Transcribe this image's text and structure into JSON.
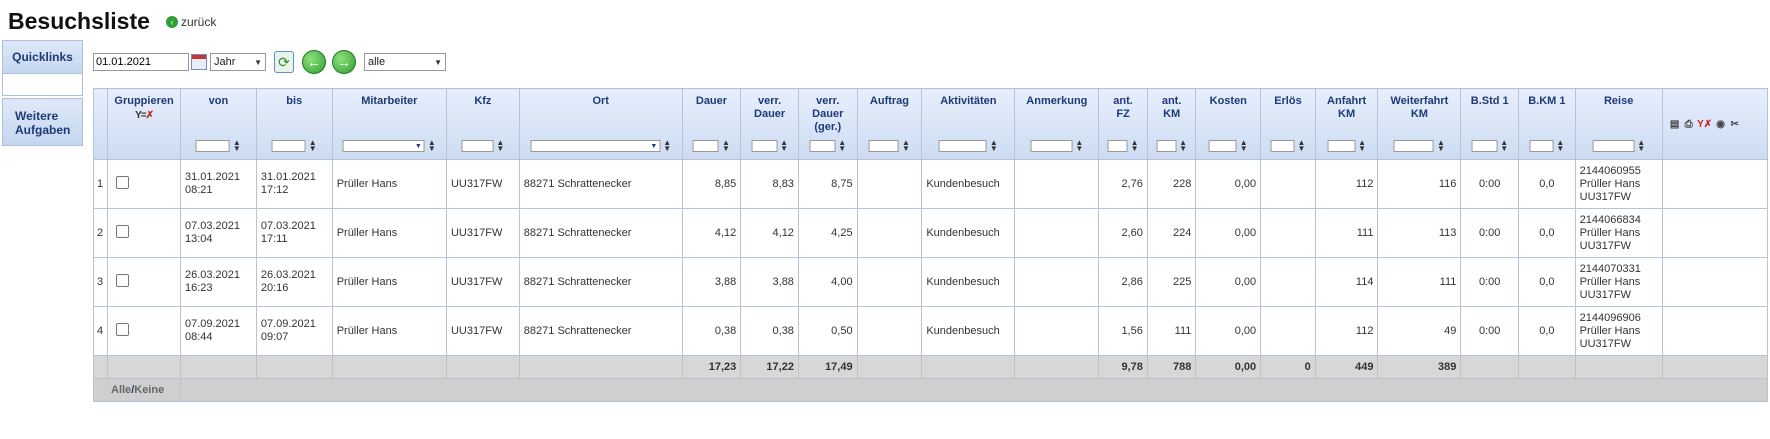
{
  "page": {
    "title": "Besuchsliste",
    "back_label": "zurück"
  },
  "sidebar": {
    "quicklinks": "Quicklinks",
    "tasks": "Weitere Aufgaben"
  },
  "filter": {
    "date": "01.01.2021",
    "period": "Jahr",
    "scope": "alle"
  },
  "table": {
    "headers": {
      "gruppieren": "Gruppieren",
      "von": "von",
      "bis": "bis",
      "mitarbeiter": "Mitarbeiter",
      "kfz": "Kfz",
      "ort": "Ort",
      "dauer": "Dauer",
      "verr_dauer": "verr. Dauer",
      "verr_dauer_ger": "verr. Dauer (ger.)",
      "auftrag": "Auftrag",
      "aktivitaeten": "Aktivitäten",
      "anmerkung": "Anmerkung",
      "ant_fz": "ant. FZ",
      "ant_km": "ant. KM",
      "kosten": "Kosten",
      "erloes": "Erlös",
      "anfahrt_km": "Anfahrt KM",
      "weiterfahrt_km": "Weiterfahrt KM",
      "bstd1": "B.Std 1",
      "bkm1": "B.KM 1",
      "reise": "Reise"
    },
    "rows": [
      {
        "idx": "1",
        "von": "31.01.2021 08:21",
        "bis": "31.01.2021 17:12",
        "mitarbeiter": "Prüller Hans",
        "kfz": "UU317FW",
        "ort": "88271 Schrattenecker",
        "dauer": "8,85",
        "verr_dauer": "8,83",
        "verr_dauer_ger": "8,75",
        "auftrag": "",
        "aktivitaeten": "Kundenbesuch",
        "anmerkung": "",
        "ant_fz": "2,76",
        "ant_km": "228",
        "kosten": "0,00",
        "erloes": "",
        "anfahrt_km": "112",
        "weiterfahrt_km": "116",
        "bstd1": "0:00",
        "bkm1": "0,0",
        "reise_id": "2144060955",
        "reise_name": "Prüller Hans",
        "reise_kfz": "UU317FW"
      },
      {
        "idx": "2",
        "von": "07.03.2021 13:04",
        "bis": "07.03.2021 17:11",
        "mitarbeiter": "Prüller Hans",
        "kfz": "UU317FW",
        "ort": "88271 Schrattenecker",
        "dauer": "4,12",
        "verr_dauer": "4,12",
        "verr_dauer_ger": "4,25",
        "auftrag": "",
        "aktivitaeten": "Kundenbesuch",
        "anmerkung": "",
        "ant_fz": "2,60",
        "ant_km": "224",
        "kosten": "0,00",
        "erloes": "",
        "anfahrt_km": "111",
        "weiterfahrt_km": "113",
        "bstd1": "0:00",
        "bkm1": "0,0",
        "reise_id": "2144066834",
        "reise_name": "Prüller Hans",
        "reise_kfz": "UU317FW"
      },
      {
        "idx": "3",
        "von": "26.03.2021 16:23",
        "bis": "26.03.2021 20:16",
        "mitarbeiter": "Prüller Hans",
        "kfz": "UU317FW",
        "ort": "88271 Schrattenecker",
        "dauer": "3,88",
        "verr_dauer": "3,88",
        "verr_dauer_ger": "4,00",
        "auftrag": "",
        "aktivitaeten": "Kundenbesuch",
        "anmerkung": "",
        "ant_fz": "2,86",
        "ant_km": "225",
        "kosten": "0,00",
        "erloes": "",
        "anfahrt_km": "114",
        "weiterfahrt_km": "111",
        "bstd1": "0:00",
        "bkm1": "0,0",
        "reise_id": "2144070331",
        "reise_name": "Prüller Hans",
        "reise_kfz": "UU317FW"
      },
      {
        "idx": "4",
        "von": "07.09.2021 08:44",
        "bis": "07.09.2021 09:07",
        "mitarbeiter": "Prüller Hans",
        "kfz": "UU317FW",
        "ort": "88271 Schrattenecker",
        "dauer": "0,38",
        "verr_dauer": "0,38",
        "verr_dauer_ger": "0,50",
        "auftrag": "",
        "aktivitaeten": "Kundenbesuch",
        "anmerkung": "",
        "ant_fz": "1,56",
        "ant_km": "111",
        "kosten": "0,00",
        "erloes": "",
        "anfahrt_km": "112",
        "weiterfahrt_km": "49",
        "bstd1": "0:00",
        "bkm1": "0,0",
        "reise_id": "2144096906",
        "reise_name": "Prüller Hans",
        "reise_kfz": "UU317FW"
      }
    ],
    "totals": {
      "dauer": "17,23",
      "verr_dauer": "17,22",
      "verr_dauer_ger": "17,49",
      "ant_fz": "9,78",
      "ant_km": "788",
      "kosten": "0,00",
      "erloes": "0",
      "anfahrt_km": "449",
      "weiterfahrt_km": "389"
    },
    "select": {
      "alle": "Alle",
      "sep": "/",
      "keine": "Keine"
    }
  }
}
